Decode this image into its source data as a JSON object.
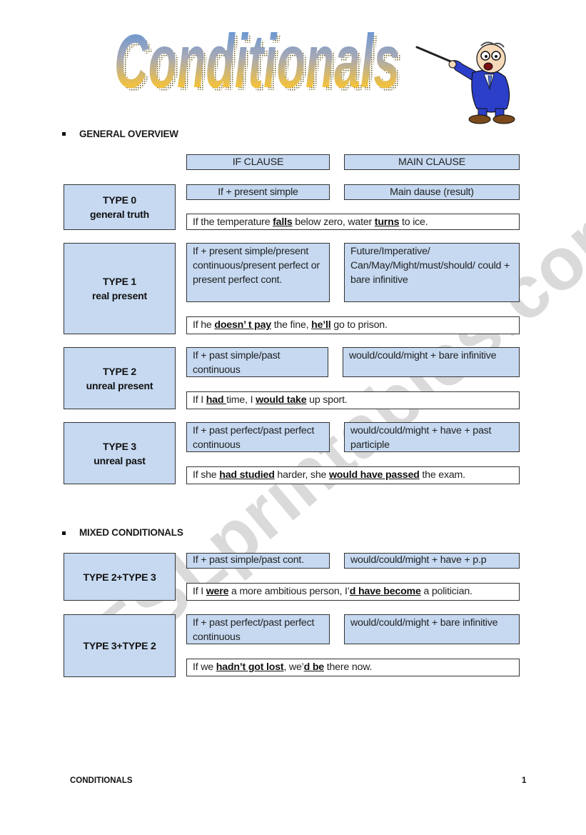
{
  "document": {
    "title": "Conditionals",
    "watermark": "ESLprintables.com",
    "footer": {
      "left": "CONDITIONALS",
      "page_number": "1"
    },
    "colors": {
      "box_fill": "#c6d9f1",
      "box_border": "#333333",
      "title_top": "#5b8fd6",
      "title_bottom": "#f8c22c"
    }
  },
  "general_overview": {
    "heading": "GENERAL OVERVIEW",
    "column_headers": {
      "if_clause": "IF CLAUSE",
      "main_clause": "MAIN CLAUSE"
    },
    "types": [
      {
        "name": "TYPE 0",
        "subtitle": "general truth",
        "if_clause": "If + present simple",
        "main_clause": "Main dause (result)",
        "example": [
          {
            "t": "If the temperature "
          },
          {
            "t": "falls",
            "b": true
          },
          {
            "t": " below zero, water "
          },
          {
            "t": "turns",
            "b": true
          },
          {
            "t": " to ice."
          }
        ]
      },
      {
        "name": "TYPE 1",
        "subtitle": "real present",
        "if_clause": "If + present simple/present continuous/present perfect or present perfect cont.",
        "main_clause": "Future/Imperative/ Can/May/Might/must/should/ could + bare infinitive",
        "example": [
          {
            "t": "If he "
          },
          {
            "t": "doesn’ t pay",
            "b": true
          },
          {
            "t": " the fine, "
          },
          {
            "t": "he’ll",
            "b": true
          },
          {
            "t": " go to prison."
          }
        ]
      },
      {
        "name": "TYPE 2",
        "subtitle": "unreal present",
        "if_clause": "If + past simple/past continuous",
        "main_clause": "would/could/might + bare infinitive",
        "example": [
          {
            "t": "If I "
          },
          {
            "t": "had ",
            "b": true
          },
          {
            "t": "time, I "
          },
          {
            "t": "would take",
            "b": true
          },
          {
            "t": " up sport."
          }
        ]
      },
      {
        "name": "TYPE 3",
        "subtitle": "unreal past",
        "if_clause": "If + past perfect/past perfect  continuous",
        "main_clause": "would/could/might  + have + past participle",
        "example": [
          {
            "t": "If she "
          },
          {
            "t": "had studied",
            "b": true
          },
          {
            "t": " harder, she "
          },
          {
            "t": "would have passed",
            "b": true
          },
          {
            "t": " the exam."
          }
        ]
      }
    ]
  },
  "mixed_conditionals": {
    "heading": "MIXED CONDITIONALS",
    "types": [
      {
        "name": "TYPE 2+TYPE 3",
        "if_clause": "If + past simple/past cont.",
        "main_clause": "would/could/might  + have + p.p",
        "example": [
          {
            "t": "If I "
          },
          {
            "t": "were",
            "b": true
          },
          {
            "t": " a more ambitious person, I’"
          },
          {
            "t": "d have become",
            "b": true
          },
          {
            "t": " a politician."
          }
        ]
      },
      {
        "name": "TYPE 3+TYPE 2",
        "if_clause": "If + past perfect/past perfect  continuous",
        "main_clause": "would/could/might + bare infinitive",
        "example": [
          {
            "t": "If we "
          },
          {
            "t": "hadn’t got lost",
            "b": true
          },
          {
            "t": ", we’"
          },
          {
            "t": "d be",
            "b": true
          },
          {
            "t": " there now."
          }
        ]
      }
    ]
  }
}
